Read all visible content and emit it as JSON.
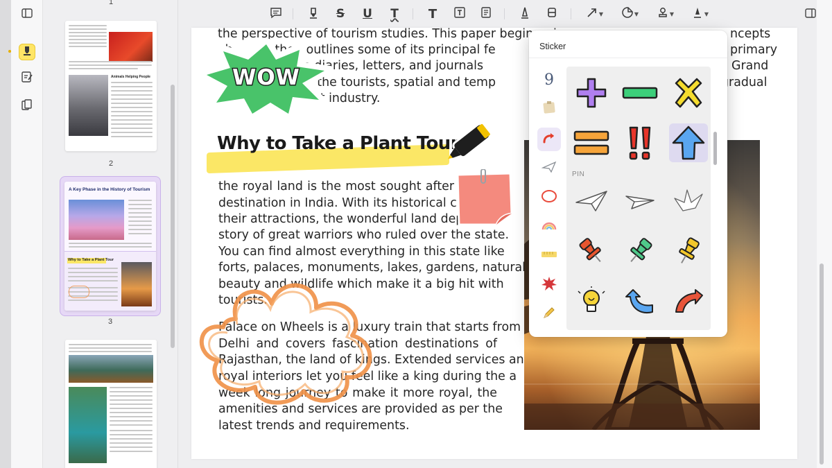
{
  "thumbnails": {
    "page_numbers": [
      "1",
      "2",
      "3"
    ],
    "page2": {
      "heading": "A Key Phase in the History of Tourism",
      "section": "Why to Take a Plant Tour"
    },
    "page1": {
      "caption": "Animals Helping People"
    }
  },
  "toolbar": {
    "items": [
      "comment",
      "highlight",
      "strikethrough",
      "underline",
      "squiggly",
      "text",
      "textbox",
      "text-callout",
      "pencil",
      "eraser",
      "shape",
      "sticker",
      "stamp",
      "signature"
    ]
  },
  "document": {
    "lines_top": [
      "the perspective of tourism studies. This paper begins wi",
      "ab        d then outlines some of its principal fe",
      "               n: the diaries, letters, and journals",
      "              mined: the tourists, spatial and temp",
      "                   ourist industry."
    ],
    "lines_top_right": [
      "ncepts",
      "primary",
      "Grand",
      "gradual"
    ],
    "heading": "Why to Take a Plant Tour",
    "para1": [
      "the royal land is the most sought after",
      "destination in India. With its historical citi",
      "their attractions, the wonderful land depi",
      "story of great warriors who ruled over the state.",
      "You can find almost everything in this state like",
      "forts, palaces, monuments, lakes, gardens, natural",
      "beauty and wildlife which make it a big hit with",
      "tourists."
    ],
    "para2": [
      "Palace on Wheels is a luxury train that starts from",
      "Delhi  and  covers  fascination  destinations  of",
      "Rajasthan, the land of kings. Extended services and",
      "royal interiors let you feel like a king during the a",
      "week long journey to make it more royal, the",
      "amenities and services are provided as per the",
      "latest trends and requirements."
    ],
    "wow_sticker_text": "WOW"
  },
  "sticker_panel": {
    "title": "Sticker",
    "section_label": "PIN",
    "categories": [
      "nine",
      "note",
      "arrow-curve",
      "paper-plane",
      "circle",
      "rainbow",
      "ruler",
      "burst",
      "pencil"
    ],
    "active_category": "arrow-curve",
    "highlighted_sticker": "blue-up-arrow"
  },
  "colors": {
    "accent_yellow": "#fbe766",
    "active_rail": "#ffe566",
    "selection_purple": "#e6d8f6",
    "sticker_purple": "#a55be6",
    "sticker_green": "#3cc06a",
    "sticker_yellow": "#f4d22a",
    "sticker_orange": "#f29a2e",
    "sticker_red": "#e33b2b",
    "sticker_blue": "#4c9cf0"
  }
}
